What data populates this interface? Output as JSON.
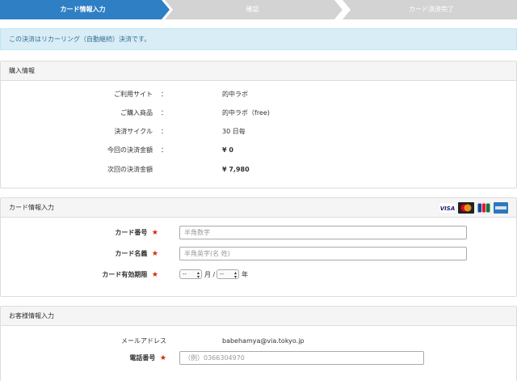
{
  "steps": [
    {
      "label": "カード情報入力",
      "active": true
    },
    {
      "label": "確認",
      "active": false
    },
    {
      "label": "カード決済完了",
      "active": false
    }
  ],
  "notice": "この決済はリカーリング（自動継続）決済です。",
  "purchase": {
    "title": "購入情報",
    "rows": [
      {
        "label": "ご利用サイト",
        "colon": "：",
        "value": "的中ラボ"
      },
      {
        "label": "ご購入商品",
        "colon": "：",
        "value": "的中ラボ（free)"
      },
      {
        "label": "決済サイクル",
        "colon": "：",
        "value": "30 日毎"
      },
      {
        "label": "今回の決済金額",
        "colon": "：",
        "value": "¥ 0"
      },
      {
        "label": "次回の決済金額",
        "colon": "",
        "value": "¥ 7,980"
      }
    ]
  },
  "card": {
    "title": "カード情報入力",
    "number_label": "カード番号",
    "number_placeholder": "半角数字",
    "name_label": "カード名義",
    "name_placeholder": "半角英字(名 姓)",
    "expiry_label": "カード有効期限",
    "month_value": "--",
    "month_unit": "月 /",
    "year_value": "--",
    "year_unit": "年",
    "required_mark": "★",
    "brands": [
      "VISA",
      "MasterCard",
      "JCB",
      "AMEX"
    ],
    "colors": {
      "visa": "#1a1f71",
      "master_red": "#eb001b",
      "master_yellow": "#f79e1b",
      "jcb_blue": "#0e4c96",
      "jcb_red": "#e21836",
      "jcb_green": "#007940",
      "amex": "#2e77bb"
    }
  },
  "customer": {
    "title": "お客様情報入力",
    "email_label": "メールアドレス",
    "email_value": "babehamya@via.tokyo.jp",
    "phone_label": "電話番号",
    "phone_placeholder": "（例）0366304970",
    "required_mark": "★"
  },
  "colors": {
    "step_active": "#2f7fc4",
    "step_inactive": "#d3d3d3",
    "notice_bg": "#d9edf7",
    "required": "#d9230f"
  }
}
